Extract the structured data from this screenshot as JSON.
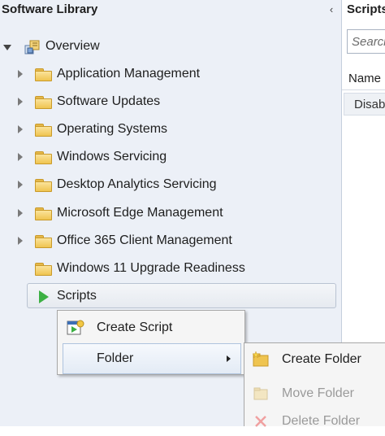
{
  "nav": {
    "title": "Software Library",
    "collapse_glyph": "‹",
    "overview": {
      "label": "Overview",
      "icon": "overview-icon"
    },
    "items": [
      {
        "label": "Application Management",
        "expandable": true
      },
      {
        "label": "Software Updates",
        "expandable": true
      },
      {
        "label": "Operating Systems",
        "expandable": true
      },
      {
        "label": "Windows Servicing",
        "expandable": true
      },
      {
        "label": "Desktop Analytics Servicing",
        "expandable": true
      },
      {
        "label": "Microsoft Edge Management",
        "expandable": true
      },
      {
        "label": "Office 365 Client Management",
        "expandable": true
      },
      {
        "label": "Windows 11 Upgrade Readiness",
        "expandable": false
      }
    ],
    "selected": {
      "label": "Scripts",
      "icon": "scripts-play-icon"
    }
  },
  "right_pane": {
    "title": "Scripts",
    "search_placeholder": "Search",
    "column_header": "Name",
    "first_cell": "Disab"
  },
  "context_menu": {
    "items": [
      {
        "label": "Create Script",
        "icon": "create-script-icon"
      },
      {
        "label": "Folder",
        "has_submenu": true
      }
    ]
  },
  "submenu": {
    "items": [
      {
        "label": "Create Folder",
        "enabled": true,
        "icon": "create-folder-icon"
      },
      {
        "label": "Move Folder",
        "enabled": false,
        "icon": "move-folder-icon"
      },
      {
        "label": "Delete Folder",
        "enabled": false,
        "icon": "delete-folder-icon"
      }
    ]
  },
  "colors": {
    "nav_bg": "#ecf0f7",
    "folder": "#efc450",
    "scripts_icon": "#3cb043",
    "highlight_border": "#aec3de"
  }
}
